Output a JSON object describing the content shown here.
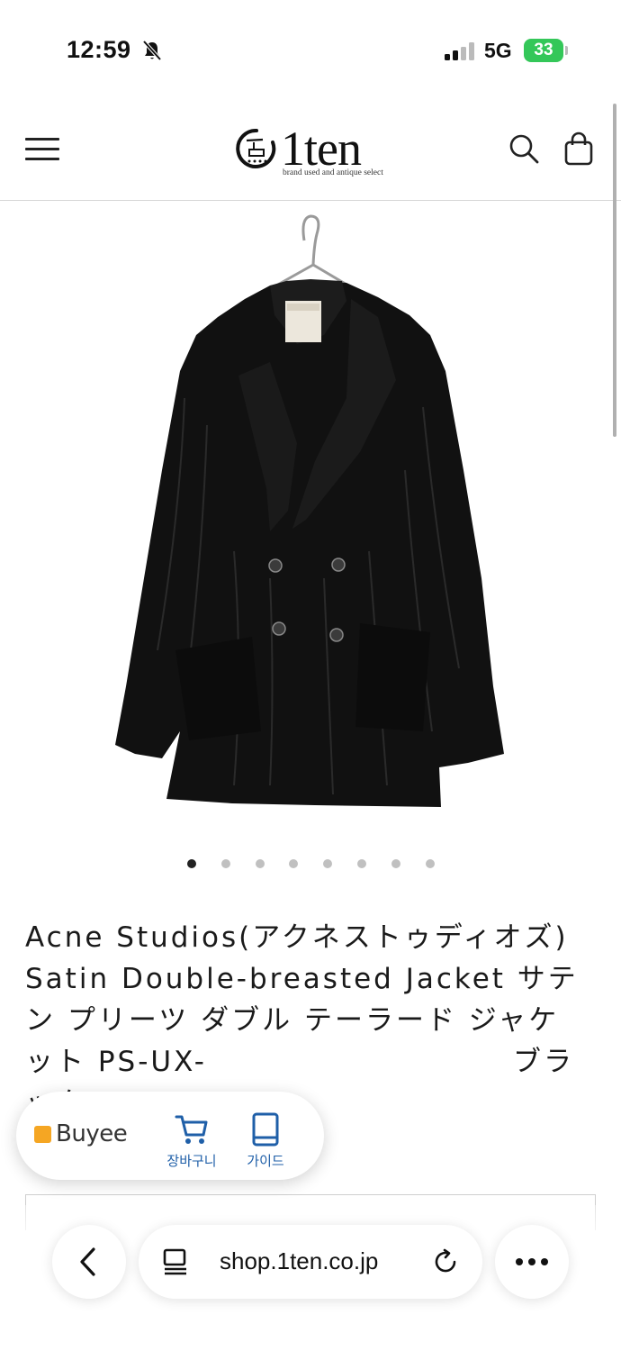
{
  "status_bar": {
    "time": "12:59",
    "network": "5G",
    "battery": "33"
  },
  "header": {
    "logo_text": "1ten",
    "logo_tagline": "brand used and antique select",
    "logo_mark": "一点"
  },
  "carousel": {
    "total": 8,
    "active_index": 0
  },
  "product": {
    "title": "Acne Studios(アクネストゥディオズ) Satin Double-breasted Jacket サテン プリーツ ダブル テーラード ジャケット PS-UX-　　　　　　　　　　ブラック"
  },
  "buyee": {
    "brand": "Buyee",
    "cart_label": "장바구니",
    "guide_label": "가이드"
  },
  "browser": {
    "url": "shop.1ten.co.jp"
  },
  "colors": {
    "battery": "#34c759",
    "buyee_accent": "#f5a623",
    "buyee_link": "#1f5fa8"
  }
}
